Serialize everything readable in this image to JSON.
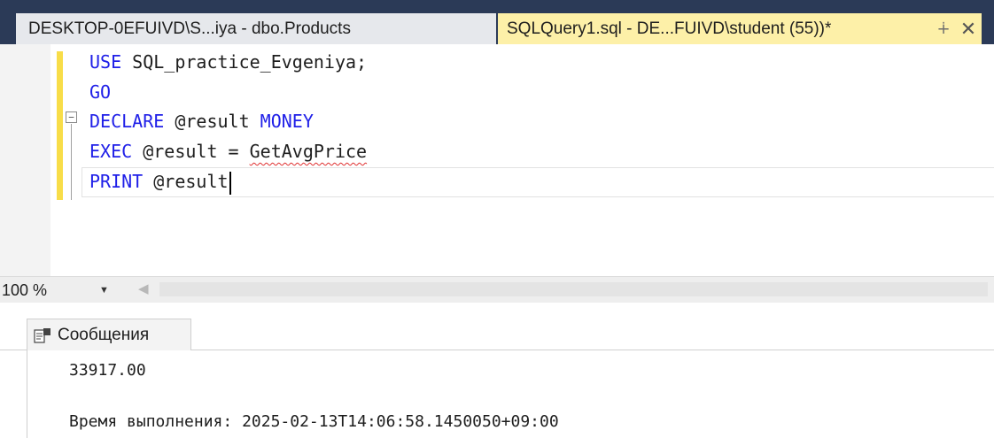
{
  "tabs": [
    {
      "label": "DESKTOP-0EFUIVD\\S...iya - dbo.Products",
      "active": false
    },
    {
      "label": "SQLQuery1.sql - DE...FUIVD\\student (55))*",
      "active": true
    }
  ],
  "tab_icons": {
    "pin": "pin-icon",
    "close": "close-icon"
  },
  "code": {
    "line1": {
      "kw": "USE",
      "rest": " SQL_practice_Evgeniya;"
    },
    "line2": {
      "kw": "GO"
    },
    "line3": {
      "kw": "DECLARE",
      "var": " @result ",
      "type": "MONEY"
    },
    "line4": {
      "kw": "EXEC",
      "mid": " @result = ",
      "proc": "GetAvgPrice"
    },
    "line5": {
      "kw": "PRINT",
      "var": " @result"
    }
  },
  "zoom": {
    "value": "100 %"
  },
  "results": {
    "tab_label": "Сообщения",
    "messages": [
      "33917.00",
      "Время выполнения: 2025-02-13T14:06:58.1450050+09:00"
    ]
  },
  "colors": {
    "tabstrip": "#2b3a57",
    "active_tab": "#fdf0a8",
    "keyword": "#2020e8",
    "change_bar": "#f8dd49"
  }
}
